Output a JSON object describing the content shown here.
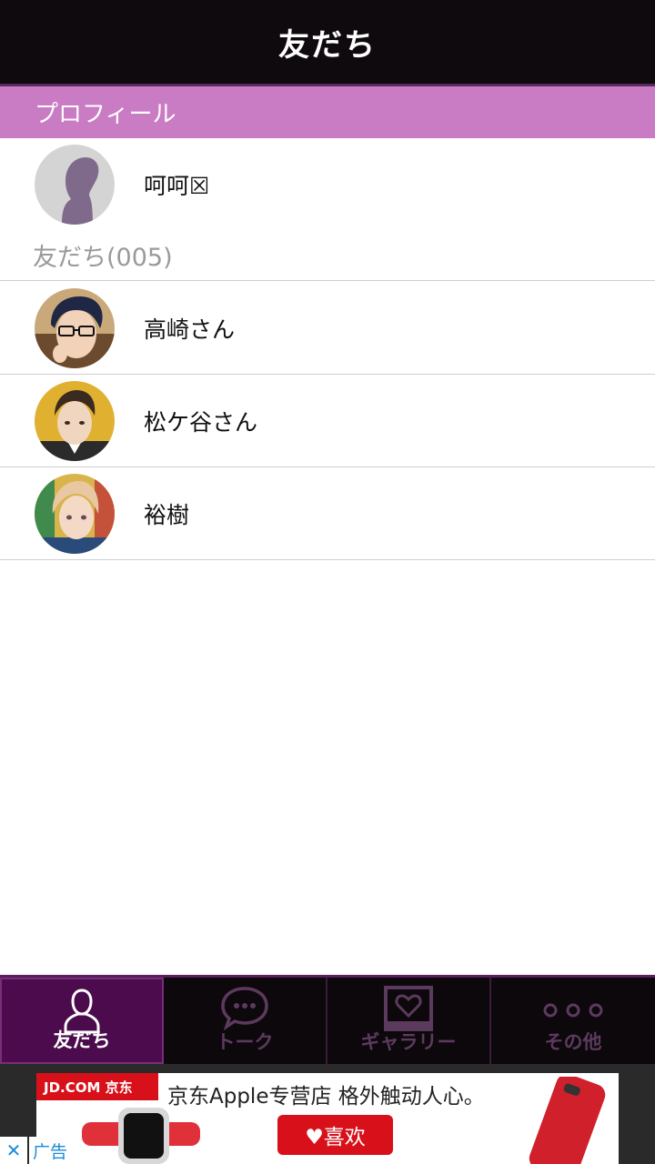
{
  "header": {
    "title": "友だち"
  },
  "profile_section": {
    "label": "プロフィール"
  },
  "profile": {
    "name": "呵呵☒"
  },
  "friends_section": {
    "label": "友だち(005)"
  },
  "friends": [
    {
      "name": "高崎さん"
    },
    {
      "name": "松ケ谷さん"
    },
    {
      "name": "裕樹"
    }
  ],
  "tabs": [
    {
      "label": "友だち",
      "icon": "person-icon",
      "active": true
    },
    {
      "label": "トーク",
      "icon": "chat-bubble-icon",
      "active": false
    },
    {
      "label": "ギャラリー",
      "icon": "heart-frame-icon",
      "active": false
    },
    {
      "label": "その他",
      "icon": "more-dots-icon",
      "active": false
    }
  ],
  "ad": {
    "brand": "JD.COM 京东",
    "headline": "京东Apple专营店  格外触动人心。",
    "like_label": "♥喜欢",
    "close_label": "✕",
    "ad_label": "广告"
  },
  "colors": {
    "accent": "#c97bc3",
    "header_bg": "#0f0a0e",
    "tab_active_bg": "#4b0b4c"
  }
}
